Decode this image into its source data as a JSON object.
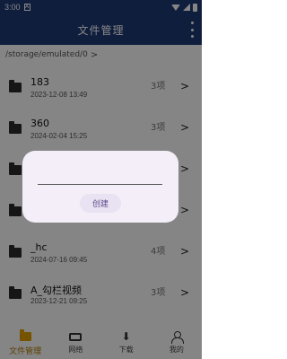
{
  "status_bar": {
    "time": "3:00",
    "sim_icon": "sim-notification-icon"
  },
  "app_bar": {
    "title": "文件管理",
    "more_icon": "more-vert-icon"
  },
  "path": {
    "text": "/storage/emulated/0",
    "chevron": ">"
  },
  "files": [
    {
      "name": "183",
      "date": "2023-12-08 13:49",
      "count": "3项",
      "chevron": ">"
    },
    {
      "name": "360",
      "date": "2024-02-04 15:25",
      "count": "3项",
      "chevron": ">"
    },
    {
      "name": "",
      "date": "",
      "count": "",
      "chevron": ">"
    },
    {
      "name": "",
      "date": "",
      "count": "",
      "chevron": ">"
    },
    {
      "name": "_hc",
      "date": "2024-07-16 09:45",
      "count": "4项",
      "chevron": ">"
    },
    {
      "name": "A_勾栏视频",
      "date": "2023-12-21 09:25",
      "count": "3项",
      "chevron": ">"
    }
  ],
  "dialog": {
    "input_value": "",
    "create_label": "创建"
  },
  "bottom_nav": [
    {
      "label": "文件管理",
      "icon": "folder-icon",
      "active": true
    },
    {
      "label": "网络",
      "icon": "router-icon",
      "active": false
    },
    {
      "label": "下载",
      "icon": "download-icon",
      "active": false
    },
    {
      "label": "我的",
      "icon": "person-icon",
      "active": false
    }
  ],
  "colors": {
    "app_bar": "#1f3a78",
    "active_nav": "#b27b00",
    "dialog_bg": "#f3eef8"
  }
}
